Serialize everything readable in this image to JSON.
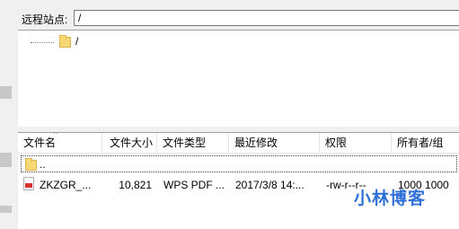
{
  "remote_site": {
    "label": "远程站点:",
    "path": "/"
  },
  "tree": {
    "root_label": "/"
  },
  "file_list": {
    "columns": [
      "文件名",
      "文件大小",
      "文件类型",
      "最近修改",
      "权限",
      "所有者/组"
    ],
    "parent_row": {
      "name": ".."
    },
    "rows": [
      {
        "name": "ZKZGR_...",
        "size": "10,821",
        "type": "WPS PDF ...",
        "modified": "2017/3/8 14:...",
        "permissions": "-rw-r--r--",
        "owner": "1000 1000"
      }
    ]
  },
  "watermark": {
    "text": "小林博客"
  },
  "icons": {
    "folder": "folder-icon",
    "pdf": "pdf-file-icon",
    "sort": "sort-ascending-icon"
  },
  "colors": {
    "folder_yellow": "#f8d775",
    "pdf_red": "#d9342b",
    "watermark_blue": "#2f6fd8"
  }
}
